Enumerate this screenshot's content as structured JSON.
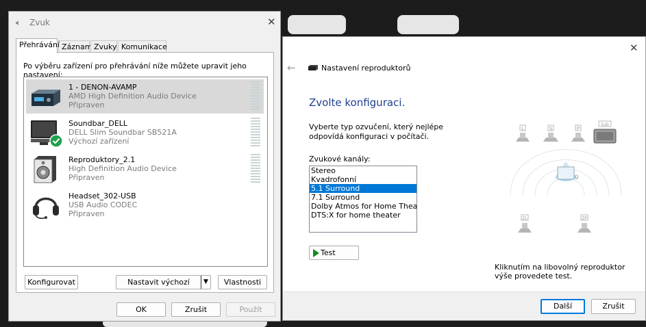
{
  "sound_dialog": {
    "title": "Zvuk",
    "tabs": [
      {
        "label": "Přehrávání",
        "active": true
      },
      {
        "label": "Záznam",
        "active": false
      },
      {
        "label": "Zvuky",
        "active": false
      },
      {
        "label": "Komunikace",
        "active": false
      }
    ],
    "instruction": "Po výběru zařízení pro přehrávání níže můžete upravit jeho nastavení:",
    "devices": [
      {
        "name": "1 - DENON-AVAMP",
        "description": "AMD High Definition Audio Device",
        "status": "Připraven",
        "icon": "av-receiver-icon",
        "selected": true
      },
      {
        "name": "Soundbar_DELL",
        "description": "DELL Slim Soundbar SB521A",
        "status": "Výchozí zařízení",
        "icon": "monitor-speaker-icon",
        "badge_icon": "default-check-icon",
        "selected": false
      },
      {
        "name": "Reproduktory_2.1",
        "description": "High Definition Audio Device",
        "status": "Připraven",
        "icon": "speaker-icon",
        "selected": false
      },
      {
        "name": "Headset_302-USB",
        "description": "USB Audio CODEC",
        "status": "Připraven",
        "icon": "headset-icon",
        "selected": false
      }
    ],
    "buttons": {
      "configure": "Konfigurovat",
      "set_default": "Nastavit výchozí",
      "properties": "Vlastnosti",
      "ok": "OK",
      "cancel": "Zrušit",
      "apply": "Použít"
    }
  },
  "speaker_wizard": {
    "title": "Nastavení reproduktorů",
    "heading": "Zvolte konfiguraci.",
    "description": "Vyberte typ ozvučení, který nejlépe odpovídá konfiguraci v počítači.",
    "channels_label": "Zvukové kanály:",
    "channels": [
      "Stereo",
      "Kvadrofonní",
      "5.1 Surround",
      "7.1 Surround",
      "Dolby Atmos for Home Theater",
      "DTS:X for home theater"
    ],
    "selected_channel": "5.1 Surround",
    "test_button": "Test",
    "speaker_labels": {
      "left": "L",
      "center": "S",
      "right": "P",
      "sub": "Sub",
      "rear_left": "ZL",
      "rear_right": "ZP"
    },
    "hint": "Kliknutím na libovolný reproduktor výše provedete test.",
    "buttons": {
      "next": "Další",
      "cancel": "Zrušit"
    }
  },
  "colors": {
    "accent": "#0078d7",
    "heading": "#1f3f8f",
    "check": "#1ea14a"
  }
}
